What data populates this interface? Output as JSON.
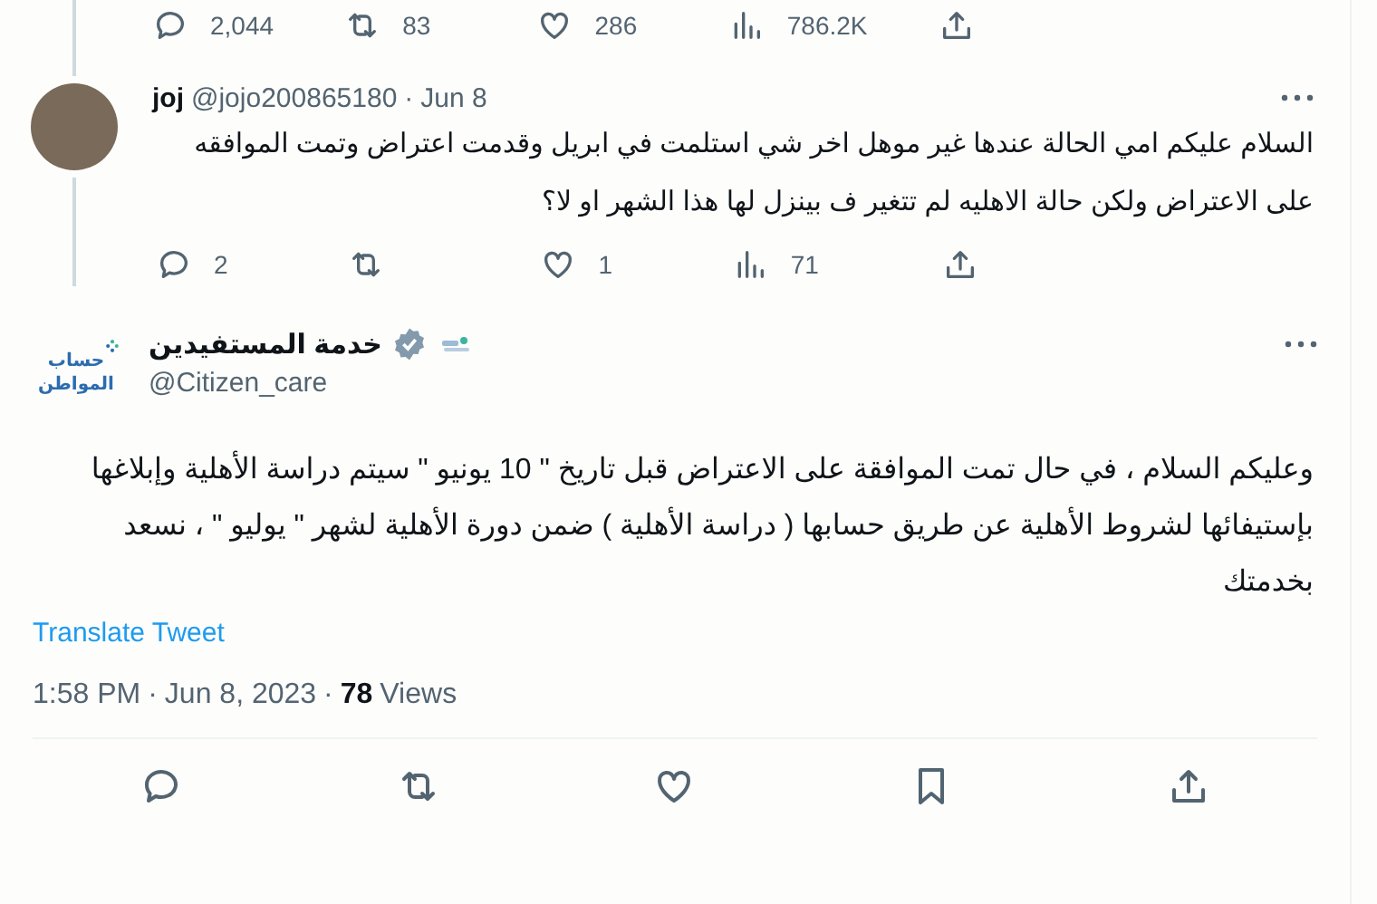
{
  "previous_tweet_actions": {
    "replies": "2,044",
    "retweets": "83",
    "likes": "286",
    "views": "786.2K"
  },
  "reply": {
    "name": "joj",
    "handle": "@jojo200865180",
    "separator": "·",
    "date": "Jun 8",
    "text": "السلام عليكم امي الحالة عندها غير موهل اخر شي استلمت في ابريل وقدمت اعتراض وتمت الموافقه على الاعتراض ولكن حالة الاهليه لم تتغير ف بينزل لها هذا الشهر او لا؟",
    "replies": "2",
    "likes": "1",
    "views": "71"
  },
  "main_tweet": {
    "logo_text": "حساب المواطن",
    "name": "خدمة المستفيدين",
    "verified": true,
    "handle": "@Citizen_care",
    "text": "وعليكم السلام ، في حال تمت الموافقة على الاعتراض قبل تاريخ \" 10 يونيو \" سيتم دراسة الأهلية وإبلاغها بإستيفائها لشروط الأهلية عن طريق حسابها ( دراسة الأهلية ) ضمن دورة الأهلية لشهر \" يوليو \" ، نسعد بخدمتك",
    "translate": "Translate Tweet",
    "time": "1:58 PM",
    "date": "Jun 8, 2023",
    "separator": "·",
    "views_count": "78",
    "views_label": "Views"
  }
}
